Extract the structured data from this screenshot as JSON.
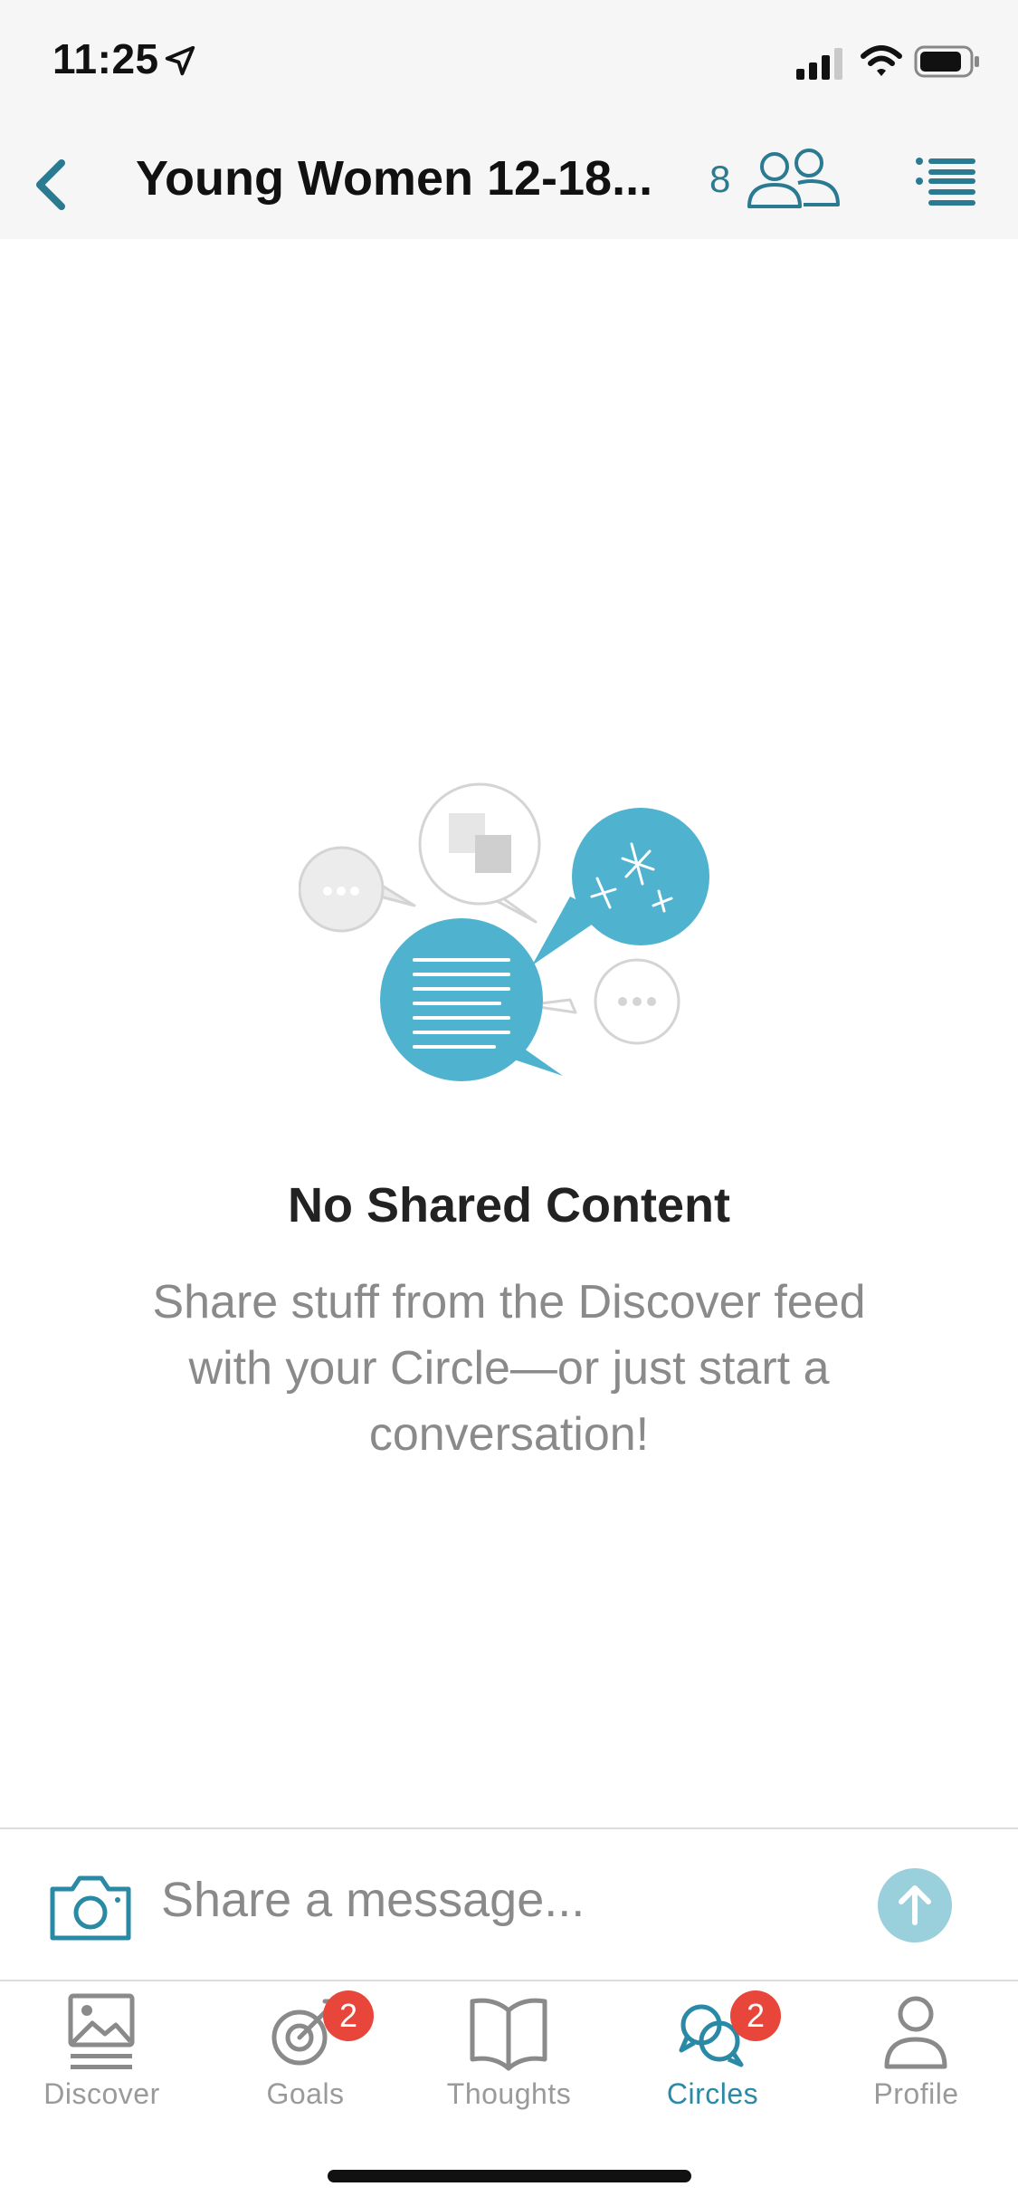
{
  "status_bar": {
    "time": "11:25",
    "icons": [
      "location-arrow-icon",
      "cellular-signal-icon",
      "wifi-icon",
      "battery-icon"
    ]
  },
  "header": {
    "back_icon": "chevron-left-icon",
    "title": "Young Women 12-18...",
    "member_count": "8",
    "members_icon": "people-icon",
    "menu_icon": "list-menu-icon"
  },
  "empty_state": {
    "illustration": "speech-bubbles-illustration",
    "title": "No Shared Content",
    "body": "Share stuff from the Discover feed with your Circle—or just start a conversation!"
  },
  "composer": {
    "camera_icon": "camera-icon",
    "placeholder": "Share a message...",
    "send_icon": "arrow-up-icon"
  },
  "tab_bar": {
    "tabs": [
      {
        "label": "Discover",
        "icon": "image-feed-icon",
        "badge": null,
        "active": false
      },
      {
        "label": "Goals",
        "icon": "target-icon",
        "badge": "2",
        "active": false
      },
      {
        "label": "Thoughts",
        "icon": "open-book-icon",
        "badge": null,
        "active": false
      },
      {
        "label": "Circles",
        "icon": "chat-circles-icon",
        "badge": "2",
        "active": true
      },
      {
        "label": "Profile",
        "icon": "person-icon",
        "badge": null,
        "active": false
      }
    ]
  },
  "colors": {
    "accent": "#2a7a92",
    "active_tab": "#2a8aa6",
    "illustration_blue": "#4fb3cf",
    "badge_red": "#e8463a",
    "send_button": "#9acfdc"
  }
}
